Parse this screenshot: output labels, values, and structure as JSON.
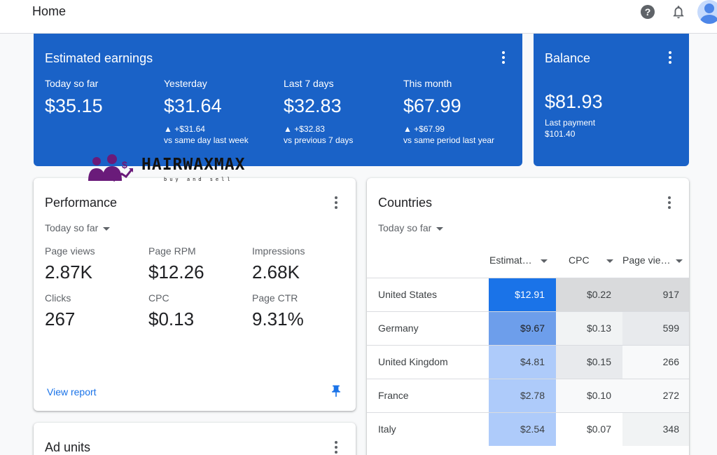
{
  "header": {
    "title": "Home",
    "help_icon": "?"
  },
  "earnings": {
    "title": "Estimated earnings",
    "metrics": [
      {
        "label": "Today so far",
        "value": "$35.15",
        "change": "",
        "compare": ""
      },
      {
        "label": "Yesterday",
        "value": "$31.64",
        "change": "▲ +$31.64",
        "compare": "vs same day last week"
      },
      {
        "label": "Last 7 days",
        "value": "$32.83",
        "change": "▲ +$32.83",
        "compare": "vs previous 7 days"
      },
      {
        "label": "This month",
        "value": "$67.99",
        "change": "▲ +$67.99",
        "compare": "vs same period last year"
      }
    ]
  },
  "balance": {
    "title": "Balance",
    "value": "$81.93",
    "last_payment_label": "Last payment",
    "last_payment_value": "$101.40"
  },
  "watermark": {
    "brand": "HAIRWAXMAX",
    "tagline": "buy and sell"
  },
  "performance": {
    "title": "Performance",
    "period": "Today so far",
    "metrics": [
      {
        "label": "Page views",
        "value": "2.87K"
      },
      {
        "label": "Page RPM",
        "value": "$12.26"
      },
      {
        "label": "Impressions",
        "value": "2.68K"
      },
      {
        "label": "Clicks",
        "value": "267"
      },
      {
        "label": "CPC",
        "value": "$0.13"
      },
      {
        "label": "Page CTR",
        "value": "9.31%"
      }
    ],
    "view_report": "View report"
  },
  "countries": {
    "title": "Countries",
    "period": "Today so far",
    "columns": [
      "Estimat…",
      "CPC",
      "Page vie…"
    ],
    "rows": [
      {
        "country": "United States",
        "earnings": "$12.91",
        "cpc": "$0.22",
        "page_views": "917"
      },
      {
        "country": "Germany",
        "earnings": "$9.67",
        "cpc": "$0.13",
        "page_views": "599"
      },
      {
        "country": "United Kingdom",
        "earnings": "$4.81",
        "cpc": "$0.15",
        "page_views": "266"
      },
      {
        "country": "France",
        "earnings": "$2.78",
        "cpc": "$0.10",
        "page_views": "272"
      },
      {
        "country": "Italy",
        "earnings": "$2.54",
        "cpc": "$0.07",
        "page_views": "348"
      }
    ]
  },
  "ad_units": {
    "title": "Ad units"
  },
  "colors": {
    "brand_blue": "#1a62c7",
    "link_blue": "#1a73e8",
    "heat_strong": "#1a73e8",
    "heat_medium": "#6d9eeb",
    "heat_light": "#aecbfa",
    "watermark_purple": "#6a1b7a"
  }
}
